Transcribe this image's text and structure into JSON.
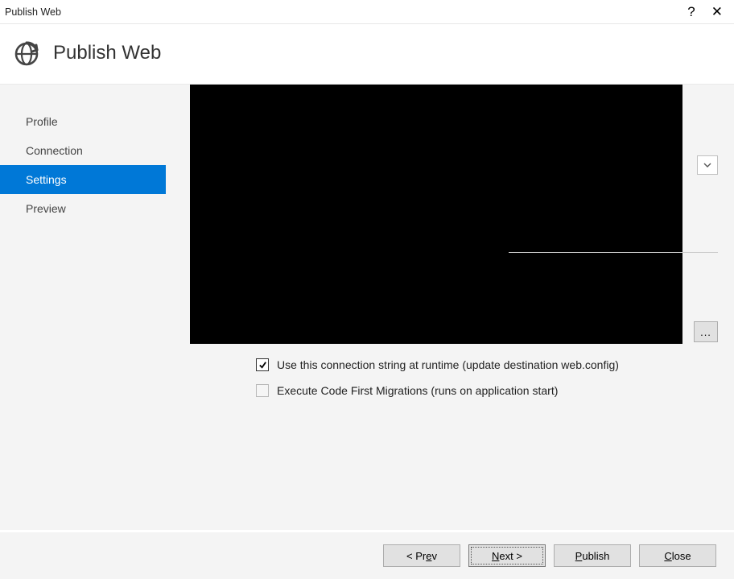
{
  "window": {
    "title": "Publish Web",
    "help_symbol": "?",
    "close_symbol": "✕"
  },
  "header": {
    "title": "Publish Web"
  },
  "sidebar": {
    "items": [
      {
        "label": "Profile",
        "active": false
      },
      {
        "label": "Connection",
        "active": false
      },
      {
        "label": "Settings",
        "active": true
      },
      {
        "label": "Preview",
        "active": false
      }
    ]
  },
  "content": {
    "ellipsis_label": "...",
    "checkbox_use_conn": {
      "label": "Use this connection string at runtime (update destination web.config)",
      "checked": true
    },
    "checkbox_migrations": {
      "label": "Execute Code First Migrations (runs on application start)",
      "checked": false
    }
  },
  "footer": {
    "prev": "< Prev",
    "next": "Next >",
    "publish": "Publish",
    "close": "Close"
  }
}
